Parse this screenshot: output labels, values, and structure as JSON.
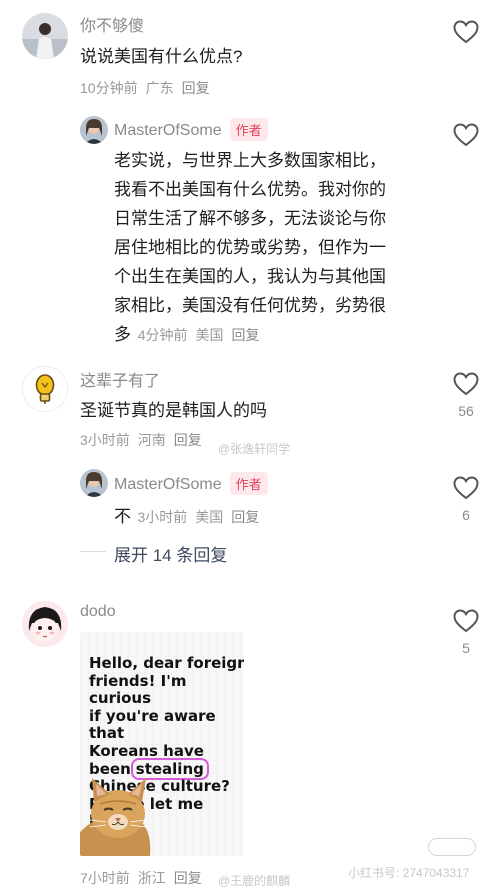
{
  "comments": [
    {
      "username": "你不够傻",
      "text": "说说美国有什么优点?",
      "time": "10分钟前",
      "location": "广东",
      "reply_label": "回复"
    },
    {
      "username": "这辈子有了",
      "text": "圣诞节真的是韩国人的吗",
      "time": "3小时前",
      "location": "河南",
      "reply_label": "回复",
      "likes": "56"
    },
    {
      "username": "dodo",
      "time": "7小时前",
      "location": "浙江",
      "reply_label": "回复",
      "likes": "5"
    }
  ],
  "replies": [
    {
      "username": "MasterOfSome",
      "badge": "作者",
      "text_lines": [
        "老实说，与世界上大多数国家相比，",
        "我看不出美国有什么优势。我对你的",
        "日常生活了解不够多，无法谈论与你",
        "居住地相比的优势或劣势，但作为一",
        "个出生在美国的人，我认为与其他国",
        "家相比，美国没有任何优势，劣势很"
      ],
      "last_word": "多",
      "time": "4分钟前",
      "location": "美国",
      "reply_label": "回复"
    },
    {
      "username": "MasterOfSome",
      "badge": "作者",
      "text": "不",
      "time": "3小时前",
      "location": "美国",
      "reply_label": "回复",
      "likes": "6"
    }
  ],
  "expand_replies": "展开 14 条回复",
  "image_card": {
    "before": "Hello, dear foreign friends! I'm curious if you're aware that Koreans have been",
    "lines": [
      "Hello, dear foreign",
      "friends! I'm curious",
      "if you're aware that",
      "Koreans have"
    ],
    "been": "been",
    "highlight": "stealing",
    "after_lines": [
      "Chinese culture?",
      "Please let me know."
    ]
  },
  "watermarks": {
    "middle": "@张逸轩同学",
    "bottom_left": "@王鹿的麒麟",
    "bottom_right": "小红书号: 2747043317"
  }
}
